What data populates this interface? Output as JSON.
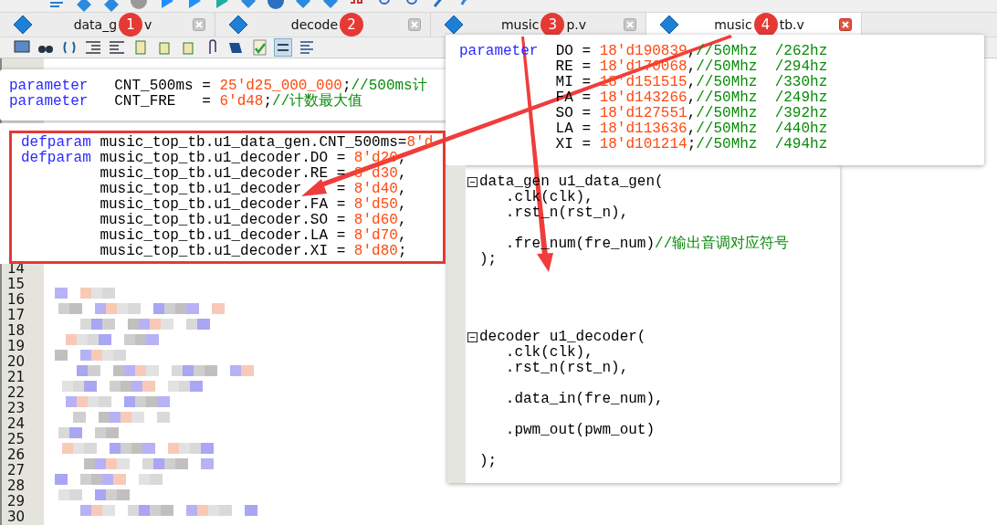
{
  "tabs": [
    {
      "label_start": "data_g",
      "badge": "1",
      "label_end": "v",
      "selected": false
    },
    {
      "label_start": "decode",
      "badge": "2",
      "selected": false
    },
    {
      "label_start": "music",
      "badge": "3",
      "label_end": "p.v",
      "selected": false
    },
    {
      "label_start": "music",
      "badge": "4",
      "label_end": "tb.v",
      "selected": true
    }
  ],
  "parameter_snippet": {
    "lines": [
      {
        "kind": "code",
        "tokens": [
          {
            "kind": "keyword",
            "text": "parameter"
          },
          {
            "kind": "plain",
            "text": "   CNT_500ms = "
          },
          {
            "kind": "number",
            "text": "25'd25_000_000"
          },
          {
            "kind": "plain",
            "text": ";"
          },
          {
            "kind": "comment",
            "text": "//500ms计"
          }
        ]
      },
      {
        "kind": "code",
        "tokens": [
          {
            "kind": "keyword",
            "text": "parameter"
          },
          {
            "kind": "plain",
            "text": "   CNT_FRE   = "
          },
          {
            "kind": "number",
            "text": "6'd48"
          },
          {
            "kind": "plain",
            "text": ";"
          },
          {
            "kind": "comment",
            "text": "//计数最大值"
          }
        ]
      }
    ]
  },
  "defparam_snippet": {
    "lines": [
      {
        "kind": "code",
        "tokens": [
          {
            "kind": "keyword",
            "text": "defparam"
          },
          {
            "kind": "plain",
            "text": " music_top_tb.u1_data_gen.CNT_500ms="
          },
          {
            "kind": "number",
            "text": "8'd"
          }
        ]
      },
      {
        "kind": "code",
        "tokens": [
          {
            "kind": "keyword",
            "text": "defparam"
          },
          {
            "kind": "plain",
            "text": " music_top_tb.u1_decoder.DO = "
          },
          {
            "kind": "number",
            "text": "8'd20"
          },
          {
            "kind": "plain",
            "text": ","
          }
        ]
      },
      {
        "kind": "code",
        "tokens": [
          {
            "kind": "plain",
            "text": "         music_top_tb.u1_decoder.RE = "
          },
          {
            "kind": "number",
            "text": "8'd30"
          },
          {
            "kind": "plain",
            "text": ","
          }
        ]
      },
      {
        "kind": "code",
        "tokens": [
          {
            "kind": "plain",
            "text": "         music_top_tb.u1_decoder"
          },
          {
            "kind": "gap"
          },
          {
            "kind": "plain",
            "text": " = "
          },
          {
            "kind": "number",
            "text": "8'd40"
          },
          {
            "kind": "plain",
            "text": ","
          }
        ]
      },
      {
        "kind": "code",
        "tokens": [
          {
            "kind": "plain",
            "text": "         music_top_tb.u1_decoder.FA = "
          },
          {
            "kind": "number",
            "text": "8'd50"
          },
          {
            "kind": "plain",
            "text": ","
          }
        ]
      },
      {
        "kind": "code",
        "tokens": [
          {
            "kind": "plain",
            "text": "         music_top_tb.u1_decoder.SO = "
          },
          {
            "kind": "number",
            "text": "8'd60"
          },
          {
            "kind": "plain",
            "text": ","
          }
        ]
      },
      {
        "kind": "code",
        "tokens": [
          {
            "kind": "plain",
            "text": "         music_top_tb.u1_decoder.LA = "
          },
          {
            "kind": "number",
            "text": "8'd70"
          },
          {
            "kind": "plain",
            "text": ","
          }
        ]
      },
      {
        "kind": "code",
        "tokens": [
          {
            "kind": "plain",
            "text": "         music_top_tb.u1_decoder.XI = "
          },
          {
            "kind": "number",
            "text": "8'd80"
          },
          {
            "kind": "plain",
            "text": ";"
          }
        ]
      }
    ]
  },
  "popup_snippet": {
    "lines": [
      {
        "kind": "code",
        "tokens": [
          {
            "kind": "keyword",
            "text": "parameter"
          },
          {
            "kind": "plain",
            "text": "  DO = "
          },
          {
            "kind": "number",
            "text": "18'd190839"
          },
          {
            "kind": "plain",
            "text": ","
          },
          {
            "kind": "comment",
            "text": "//50Mhz  /262hz"
          }
        ]
      },
      {
        "kind": "code",
        "tokens": [
          {
            "kind": "plain",
            "text": "           RE = "
          },
          {
            "kind": "number",
            "text": "18'd170068"
          },
          {
            "kind": "plain",
            "text": ","
          },
          {
            "kind": "comment",
            "text": "//50Mhz  /294hz"
          }
        ]
      },
      {
        "kind": "code",
        "tokens": [
          {
            "kind": "plain",
            "text": "           MI = "
          },
          {
            "kind": "number",
            "text": "18'd151515"
          },
          {
            "kind": "plain",
            "text": ","
          },
          {
            "kind": "comment",
            "text": "//50Mhz  /330hz"
          }
        ]
      },
      {
        "kind": "code",
        "tokens": [
          {
            "kind": "plain",
            "text": "           FA = "
          },
          {
            "kind": "number",
            "text": "18'd143266"
          },
          {
            "kind": "plain",
            "text": ","
          },
          {
            "kind": "comment",
            "text": "//50Mhz  /249hz"
          }
        ]
      },
      {
        "kind": "code",
        "tokens": [
          {
            "kind": "plain",
            "text": "           SO = "
          },
          {
            "kind": "number",
            "text": "18'd127551"
          },
          {
            "kind": "plain",
            "text": ","
          },
          {
            "kind": "comment",
            "text": "//50Mhz  /392hz"
          }
        ]
      },
      {
        "kind": "code",
        "tokens": [
          {
            "kind": "plain",
            "text": "           LA = "
          },
          {
            "kind": "number",
            "text": "18'd113636"
          },
          {
            "kind": "plain",
            "text": ","
          },
          {
            "kind": "comment",
            "text": "//50Mhz  /440hz"
          }
        ]
      },
      {
        "kind": "code",
        "tokens": [
          {
            "kind": "plain",
            "text": "           XI = "
          },
          {
            "kind": "number",
            "text": "18'd101214"
          },
          {
            "kind": "plain",
            "text": ";"
          },
          {
            "kind": "comment",
            "text": "//50Mhz  /494hz"
          }
        ]
      }
    ]
  },
  "instance_snippet": {
    "lines": [
      {
        "kind": "fold_start",
        "tokens": [
          {
            "kind": "plain",
            "text": "data_gen u1_data_gen("
          }
        ]
      },
      {
        "kind": "code",
        "tokens": [
          {
            "kind": "plain",
            "text": "   .clk(clk),"
          }
        ]
      },
      {
        "kind": "code",
        "tokens": [
          {
            "kind": "plain",
            "text": "   .rst_n(rst_n),"
          }
        ]
      },
      {
        "kind": "blank"
      },
      {
        "kind": "code",
        "tokens": [
          {
            "kind": "plain",
            "text": "   .fre_num(fre_num)"
          },
          {
            "kind": "comment",
            "text": "//输出音调对应符号"
          }
        ]
      },
      {
        "kind": "code",
        "tokens": [
          {
            "kind": "plain",
            "text": ");"
          }
        ]
      },
      {
        "kind": "blank"
      },
      {
        "kind": "blank"
      },
      {
        "kind": "blank"
      },
      {
        "kind": "blank"
      },
      {
        "kind": "fold_start",
        "tokens": [
          {
            "kind": "plain",
            "text": "decoder u1_decoder("
          }
        ]
      },
      {
        "kind": "code",
        "tokens": [
          {
            "kind": "plain",
            "text": "   .clk(clk),"
          }
        ]
      },
      {
        "kind": "code",
        "tokens": [
          {
            "kind": "plain",
            "text": "   .rst_n(rst_n),"
          }
        ]
      },
      {
        "kind": "blank"
      },
      {
        "kind": "code",
        "tokens": [
          {
            "kind": "plain",
            "text": "   .data_in(fre_num),"
          }
        ]
      },
      {
        "kind": "blank"
      },
      {
        "kind": "code",
        "tokens": [
          {
            "kind": "plain",
            "text": "   .pwm_out(pwm_out)"
          }
        ]
      },
      {
        "kind": "blank"
      },
      {
        "kind": "code",
        "tokens": [
          {
            "kind": "plain",
            "text": ");"
          }
        ]
      }
    ]
  },
  "line_numbers": [
    "14",
    "15",
    "16",
    "17",
    "18",
    "19",
    "20",
    "21",
    "22",
    "23",
    "24",
    "25",
    "26",
    "27",
    "28",
    "29",
    "30"
  ]
}
